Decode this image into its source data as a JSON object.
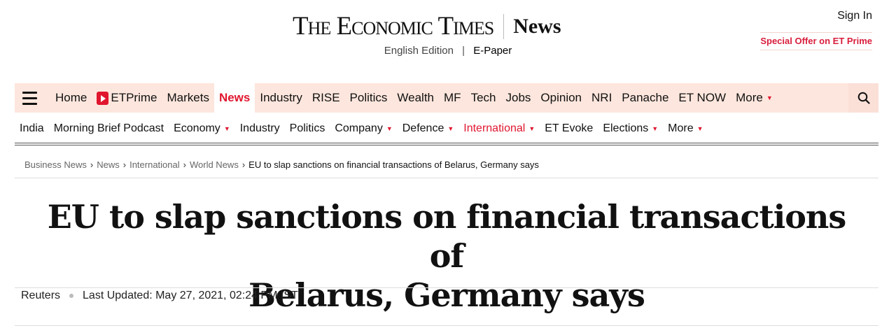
{
  "header": {
    "logo_text": "The Economic Times",
    "section": "News",
    "edition": "English Edition",
    "separator": "|",
    "epaper": "E-Paper",
    "sign_in": "Sign In",
    "special_offer": "Special Offer on ET Prime"
  },
  "main_nav": {
    "items": [
      {
        "label": "Home"
      },
      {
        "label": "ETPrime",
        "icon": "etprime-play-icon"
      },
      {
        "label": "Markets"
      },
      {
        "label": "News",
        "active": true
      },
      {
        "label": "Industry"
      },
      {
        "label": "RISE"
      },
      {
        "label": "Politics"
      },
      {
        "label": "Wealth"
      },
      {
        "label": "MF"
      },
      {
        "label": "Tech"
      },
      {
        "label": "Jobs"
      },
      {
        "label": "Opinion"
      },
      {
        "label": "NRI"
      },
      {
        "label": "Panache"
      },
      {
        "label": "ET NOW"
      },
      {
        "label": "More",
        "dropdown": true
      }
    ],
    "search_icon": "search-icon",
    "menu_icon": "hamburger-menu-icon",
    "accent_color": "#e0162e",
    "background_color": "#fde6dd"
  },
  "sub_nav": {
    "items": [
      {
        "label": "India"
      },
      {
        "label": "Morning Brief Podcast"
      },
      {
        "label": "Economy",
        "dropdown": true
      },
      {
        "label": "Industry"
      },
      {
        "label": "Politics"
      },
      {
        "label": "Company",
        "dropdown": true
      },
      {
        "label": "Defence",
        "dropdown": true
      },
      {
        "label": "International",
        "dropdown": true,
        "active": true
      },
      {
        "label": "ET Evoke"
      },
      {
        "label": "Elections",
        "dropdown": true
      },
      {
        "label": "More",
        "dropdown": true
      }
    ]
  },
  "breadcrumb": {
    "items": [
      "Business News",
      "News",
      "International",
      "World News"
    ],
    "current": "EU to slap sanctions on financial transactions of Belarus, Germany says",
    "separator": "›"
  },
  "article": {
    "headline_line1": "EU to slap sanctions on financial transactions of",
    "headline_line2": "Belarus, Germany says",
    "source": "Reuters",
    "updated": "Last Updated: May 27, 2021, 02:24 PM IST"
  }
}
